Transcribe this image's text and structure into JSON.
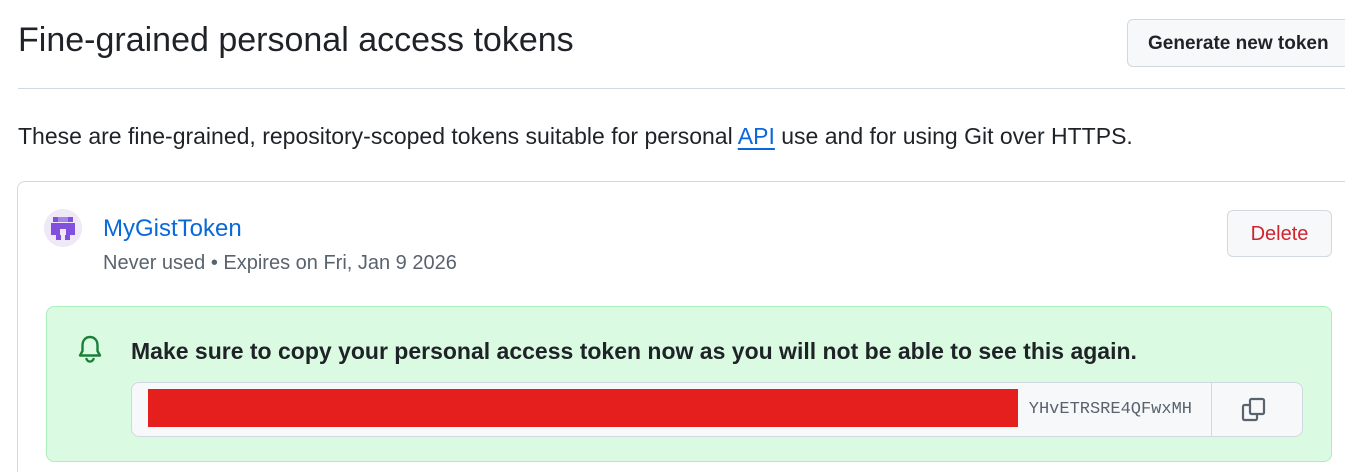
{
  "header": {
    "title": "Fine-grained personal access tokens",
    "generate_button_label": "Generate new token"
  },
  "description": {
    "before_link": "These are fine-grained, repository-scoped tokens suitable for personal ",
    "link_text": "API",
    "after_link": " use and for using Git over HTTPS."
  },
  "token": {
    "name": "MyGistToken",
    "meta": "Never used • Expires on Fri, Jan 9 2026",
    "delete_label": "Delete",
    "avatar_icon": "identicon-avatar",
    "avatar_color": "#8250df"
  },
  "flash": {
    "icon": "bell-icon",
    "message": "Make sure to copy your personal access token now as you will not be able to see this again.",
    "token_visible_text": "YHvETRSRE4QFwxMH",
    "copy_icon": "copy-icon"
  },
  "colors": {
    "link": "#0969da",
    "danger": "#d1242f",
    "success_bg": "#dafbe1",
    "success_icon": "#1a7f37",
    "redaction": "#e51e1e"
  }
}
